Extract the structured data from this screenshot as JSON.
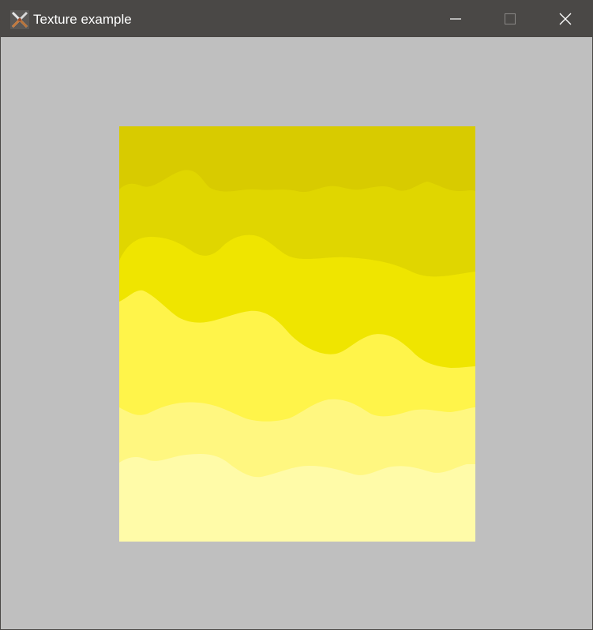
{
  "window": {
    "title": "Texture example",
    "background_color": "#bfbfbf",
    "titlebar_color": "#4a4846"
  },
  "title_bar": {
    "app_icon": "crossed-swords-icon",
    "minimize_icon": "minimize-icon",
    "maximize_icon": "maximize-icon",
    "close_icon": "close-icon"
  },
  "texture": {
    "description_icon": "yellow-wave-texture",
    "band_colors": [
      "#d8cb00",
      "#e0d600",
      "#efe500",
      "#fff44a",
      "#fff780",
      "#fffba8"
    ]
  }
}
